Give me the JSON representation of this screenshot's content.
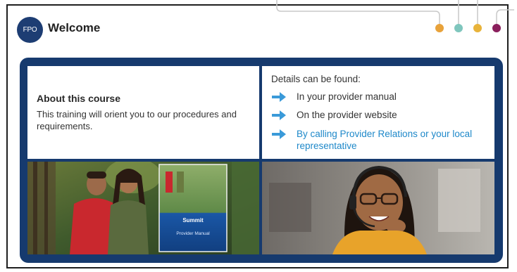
{
  "header": {
    "logo_text": "FPO",
    "title": "Welcome"
  },
  "dots": [
    "#e8a23a",
    "#7fc6bd",
    "#e8b33a",
    "#8a1f5c"
  ],
  "about": {
    "heading": "About this course",
    "body": "This training will orient you to our procedures and requirements."
  },
  "details": {
    "heading": "Details can be found:",
    "items": [
      {
        "label": "In your provider manual"
      },
      {
        "label": "On the provider website"
      },
      {
        "label": "By calling Provider Relations or your local representative"
      }
    ]
  },
  "photos": {
    "left_manual_brand": "Summit",
    "left_manual_title": "Provider Manual"
  },
  "colors": {
    "navy": "#163a6e",
    "arrow": "#3a9ad9",
    "link": "#1e88c9"
  }
}
